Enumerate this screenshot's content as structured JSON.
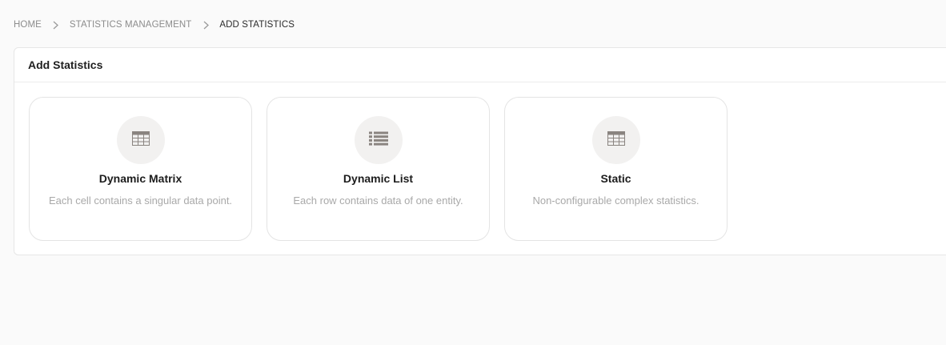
{
  "breadcrumb": {
    "home": "HOME",
    "management": "STATISTICS MANAGEMENT",
    "current": "ADD STATISTICS"
  },
  "panel": {
    "title": "Add Statistics"
  },
  "cards": [
    {
      "title": "Dynamic Matrix",
      "description": "Each cell contains a singular data point.",
      "icon": "table-grid-icon"
    },
    {
      "title": "Dynamic List",
      "description": "Each row contains data of one entity.",
      "icon": "list-icon"
    },
    {
      "title": "Static",
      "description": "Non-configurable complex statistics.",
      "icon": "table-grid-icon"
    }
  ],
  "colors": {
    "background": "#fafafa",
    "panel": "#ffffff",
    "icon": "#8a8480",
    "icon_circle": "#f2f1f0",
    "muted_text": "#a9a9a9"
  }
}
